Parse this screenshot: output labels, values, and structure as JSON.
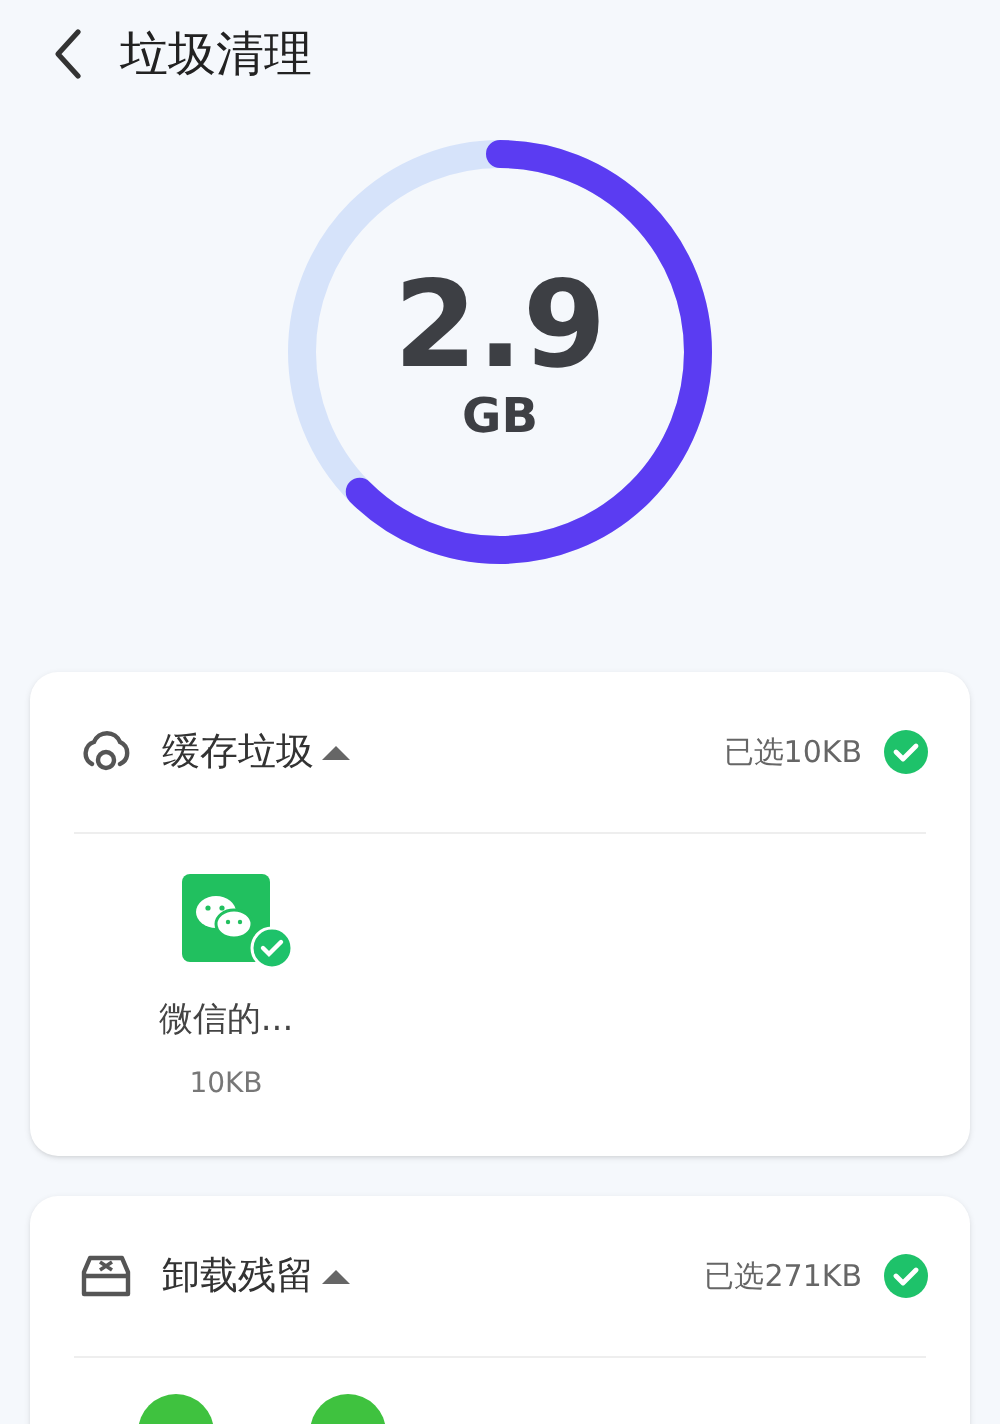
{
  "header": {
    "title": "垃圾清理"
  },
  "summary": {
    "value": "2.9",
    "unit": "GB"
  },
  "sections": [
    {
      "kind": "cache",
      "title": "缓存垃圾",
      "expanded": true,
      "selected_text": "已选10KB",
      "checked": true,
      "items": [
        {
          "kind": "chat-app",
          "name": "微信的...",
          "size": "10KB",
          "checked": true
        }
      ]
    },
    {
      "kind": "residual",
      "title": "卸载残留",
      "expanded": true,
      "selected_text": "已选271KB",
      "checked": true,
      "items": [
        {
          "kind": "round-app"
        },
        {
          "kind": "round-app"
        }
      ]
    }
  ]
}
